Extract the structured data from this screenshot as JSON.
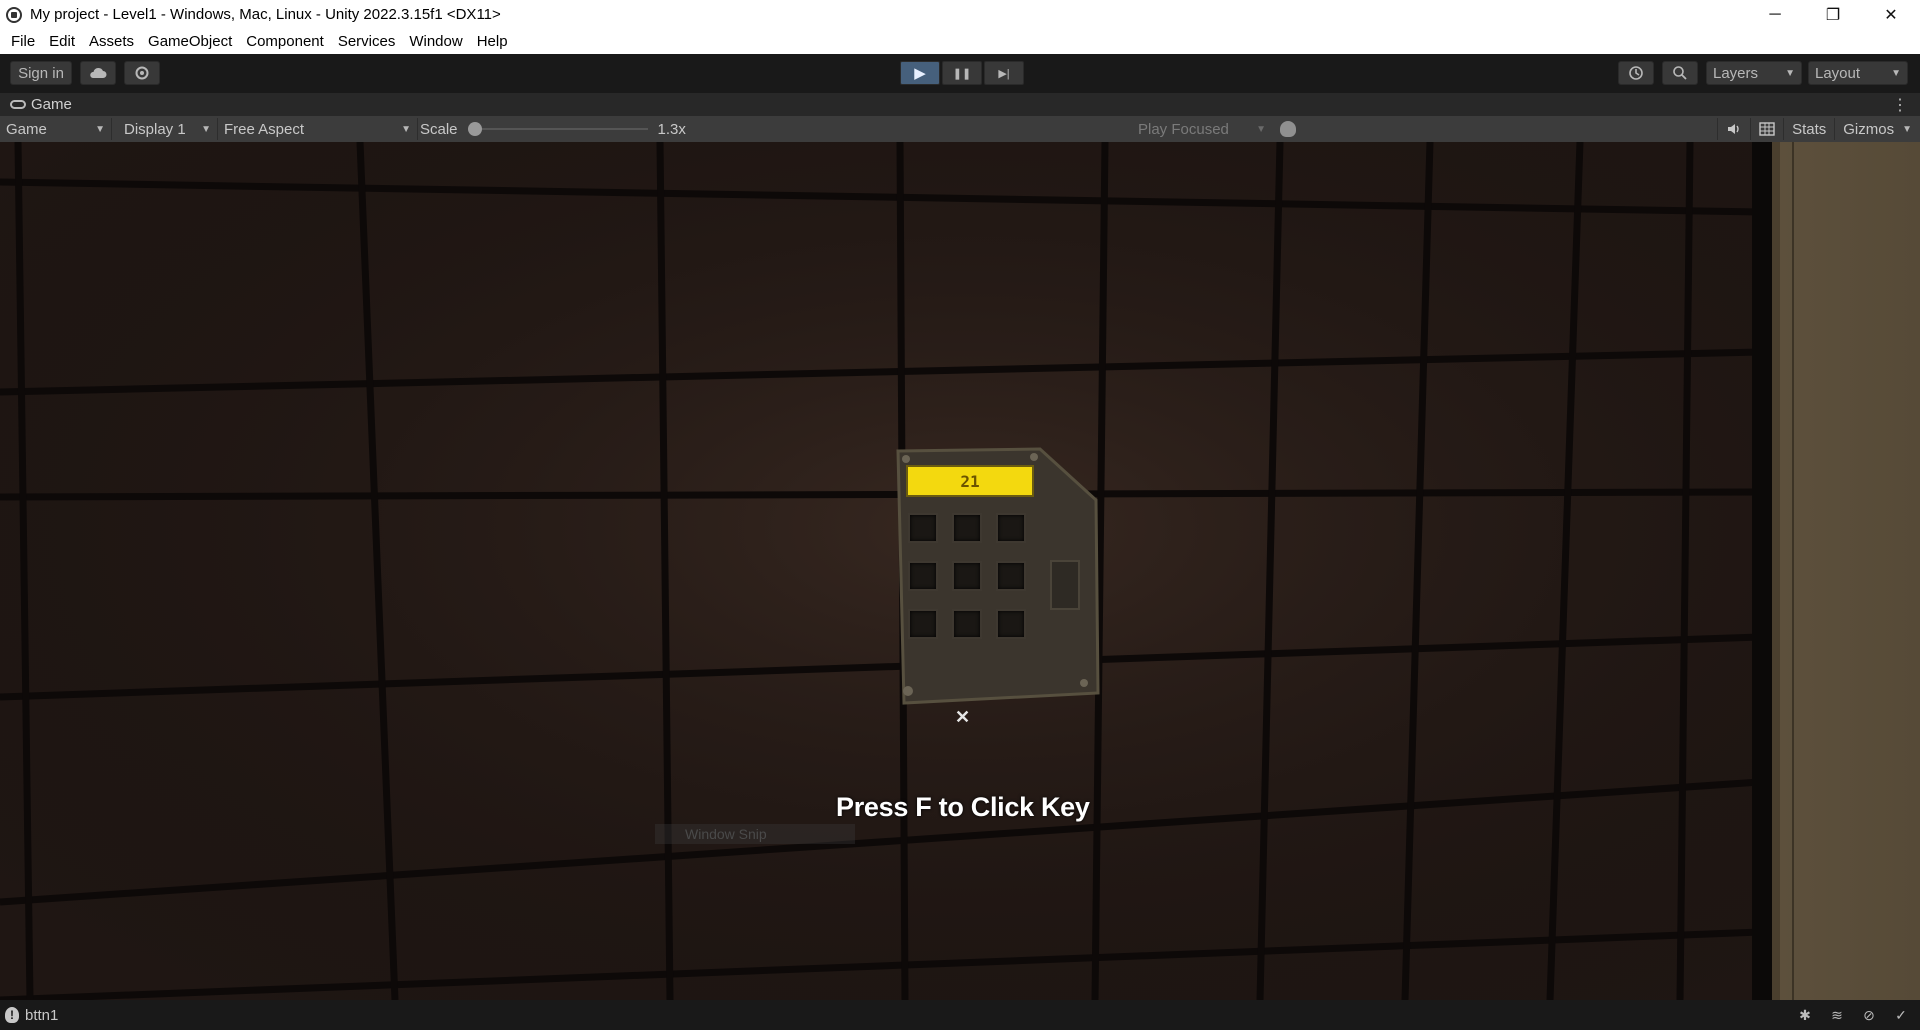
{
  "window": {
    "title": "My project - Level1 - Windows, Mac, Linux - Unity 2022.3.15f1 <DX11>",
    "minimize_glyph": "─",
    "restore_glyph": "❐",
    "close_glyph": "✕"
  },
  "menu": [
    "File",
    "Edit",
    "Assets",
    "GameObject",
    "Component",
    "Services",
    "Window",
    "Help"
  ],
  "toolbar": {
    "sign_in_label": "Sign in",
    "layers_label": "Layers",
    "layout_label": "Layout",
    "play_glyph": "▶",
    "pause_glyph": "❚❚",
    "step_glyph": "▶|"
  },
  "game_tab": {
    "label": "Game"
  },
  "game_view_bar": {
    "view_select": "Game",
    "display_select": "Display 1",
    "aspect_select": "Free Aspect",
    "scale_label": "Scale",
    "scale_value": "1.3x",
    "scale_fraction": 0.0,
    "play_mode_select": "Play Focused",
    "stats_label": "Stats",
    "gizmos_label": "Gizmos"
  },
  "game_scene": {
    "keypad_display": "21",
    "crosshair": "✕",
    "prompt": "Press F to Click Key",
    "ghost_overlay": "Window Snip",
    "colors": {
      "wall": "#1f1613",
      "tile_seam": "#0d0908",
      "keypad_display": "#f3d90f",
      "door": "#564a37"
    }
  },
  "status": {
    "message": "bttn1",
    "icon": "info-icon"
  },
  "colors": {
    "play_button_active": "#46607c",
    "editor_bg": "#191919",
    "toolbar_bg": "#3c3c3c"
  }
}
